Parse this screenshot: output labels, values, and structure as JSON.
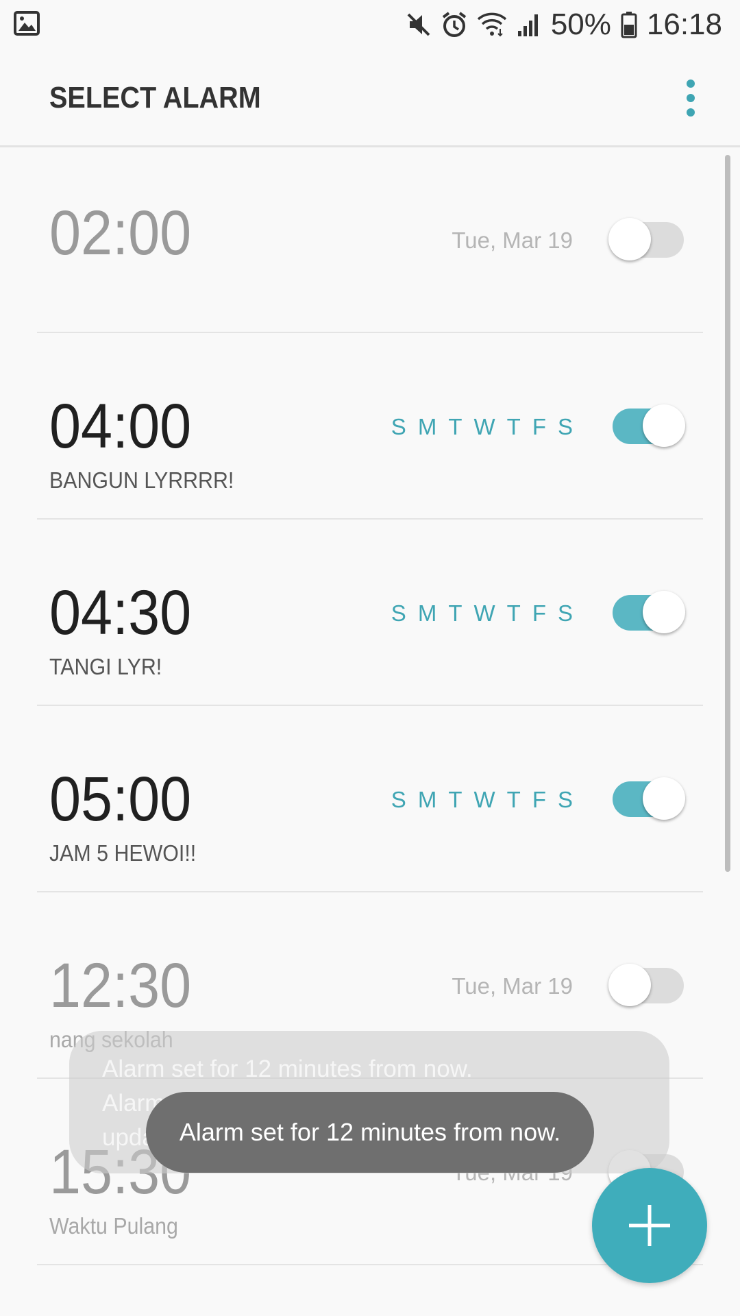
{
  "status_bar": {
    "gallery_icon": "image-icon",
    "battery_text": "50%",
    "time": "16:18"
  },
  "header": {
    "title": "SELECT ALARM",
    "more_icon": "more-vert-icon"
  },
  "colors": {
    "accent": "#3fa5b3",
    "toggle_on": "#5bb7c4",
    "fab": "#3fadbb"
  },
  "alarms": [
    {
      "time": "02:00",
      "label": "",
      "date": "Tue, Mar 19",
      "days": [],
      "enabled": false
    },
    {
      "time": "04:00",
      "label": "BANGUN LYRRRR!",
      "date": "",
      "days": [
        "S",
        "M",
        "T",
        "W",
        "T",
        "F",
        "S"
      ],
      "enabled": true
    },
    {
      "time": "04:30",
      "label": "TANGI LYR!",
      "date": "",
      "days": [
        "S",
        "M",
        "T",
        "W",
        "T",
        "F",
        "S"
      ],
      "enabled": true
    },
    {
      "time": "05:00",
      "label": "JAM 5 HEWOI!!",
      "date": "",
      "days": [
        "S",
        "M",
        "T",
        "W",
        "T",
        "F",
        "S"
      ],
      "enabled": true
    },
    {
      "time": "12:30",
      "label": "nang sekolah",
      "date": "Tue, Mar 19",
      "days": [],
      "enabled": false
    },
    {
      "time": "15:30",
      "label": "Waktu Pulang",
      "date": "Tue, Mar 19",
      "days": [],
      "enabled": false
    }
  ],
  "toast_background": {
    "line1": "Alarm set for 12 minutes from now.",
    "line2": "Alarm already set for 16:30. Existing alarm",
    "line3": "updated."
  },
  "toast": {
    "message": "Alarm set for 12 minutes from now."
  },
  "fab": {
    "icon": "plus-icon"
  }
}
